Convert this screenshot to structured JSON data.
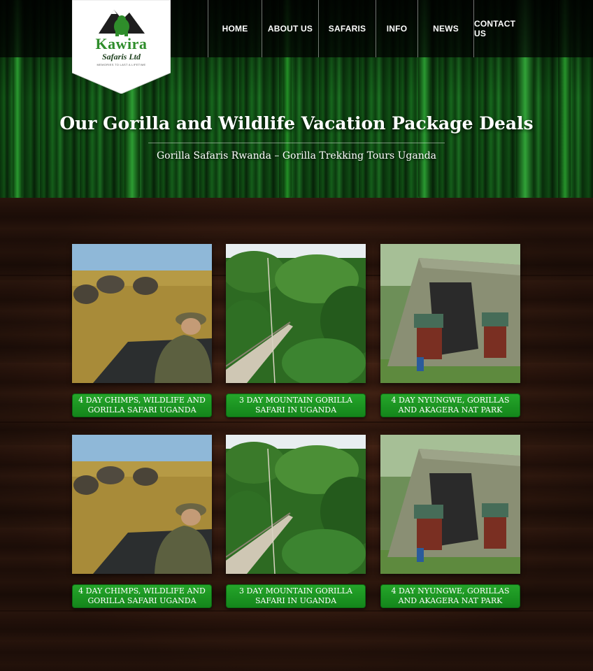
{
  "brand": {
    "name": "Kawira",
    "sub": "Safaris Ltd",
    "tagline": "MEMORIES TO LAST A LIFETIME",
    "logo_icon": "gorilla-mountain-logo",
    "accent_color": "#2f8d2b"
  },
  "nav": {
    "items": [
      {
        "label": "HOME"
      },
      {
        "label": "ABOUT US"
      },
      {
        "label": "SAFARIS"
      },
      {
        "label": "INFO"
      },
      {
        "label": "NEWS"
      },
      {
        "label": "CONTACT US"
      }
    ]
  },
  "hero": {
    "title": "Our Gorilla and Wildlife Vacation Package Deals",
    "subtitle": "Gorilla Safaris Rwanda – Gorilla Trekking Tours Uganda"
  },
  "packages": [
    {
      "image": "elephants-safari-jeep",
      "line1": "4 DAY CHIMPS, WILDLIFE AND",
      "line2": "GORILLA SAFARI UGANDA"
    },
    {
      "image": "forest-canopy-walkway",
      "line1": "3 DAY MOUNTAIN GORILLA",
      "line2": "SAFARI IN UGANDA"
    },
    {
      "image": "camping-tent-chairs",
      "line1": "4 DAY NYUNGWE, GORILLAS",
      "line2": "AND AKAGERA NAT PARK"
    },
    {
      "image": "elephants-safari-jeep",
      "line1": "4 DAY CHIMPS, WILDLIFE AND",
      "line2": "GORILLA SAFARI UGANDA"
    },
    {
      "image": "forest-canopy-walkway",
      "line1": "3 DAY MOUNTAIN GORILLA",
      "line2": "SAFARI IN UGANDA"
    },
    {
      "image": "camping-tent-chairs",
      "line1": "4 DAY NYUNGWE, GORILLAS",
      "line2": "AND AKAGERA NAT PARK"
    }
  ]
}
